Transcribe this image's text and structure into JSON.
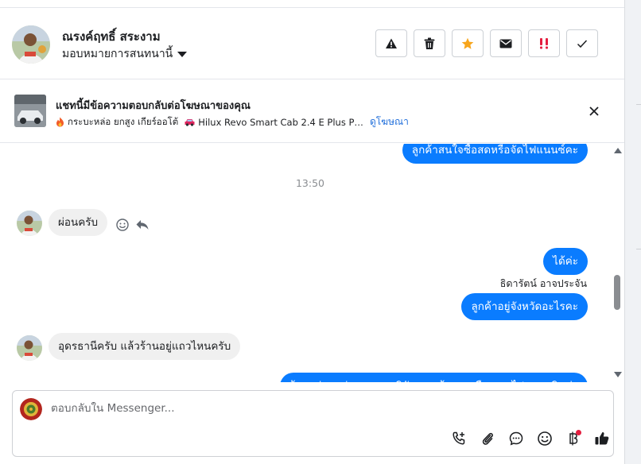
{
  "header": {
    "contact_name": "ณรงค์ฤทธิ์ สระงาม",
    "assign_label": "มอบหมายการสนทนานี้",
    "actions": [
      "warning-icon",
      "trash-icon",
      "star-icon",
      "envelope-icon",
      "spam-icon",
      "check-icon"
    ],
    "colors": {
      "star": "#f7a51c",
      "spam": "#e41e3f"
    }
  },
  "ad": {
    "title": "แชทนี้มีข้อความตอบกลับต่อโฆษณาของคุณ",
    "description_fire": "กระบะหล่อ ยกสูง เกียร์ออโต้",
    "description_car": "Hilux Revo Smart Cab 2.4 E Plus P…",
    "link_label": "ดูโฆษณา"
  },
  "thread": {
    "messages": [
      {
        "direction": "out",
        "text": "ลูกค้าสนใจซื้อสดหรือจัดไฟแนนซ์คะ"
      },
      {
        "type": "timestamp",
        "text": "13:50"
      },
      {
        "direction": "in",
        "text": "ผ่อนครับ"
      },
      {
        "direction": "out",
        "text": "ได้ค่ะ"
      },
      {
        "type": "sender",
        "text": "ธิดารัตน์ อาจประจัน"
      },
      {
        "direction": "out",
        "text": "ลูกค้าอยู่จังหวัดอะไรคะ"
      },
      {
        "direction": "in",
        "text": "อุดรธานีครับ แล้วร้านอยู่แถวไหนครับ"
      },
      {
        "direction": "out",
        "text": "ร้านอยู่อุดรค่ะ แถวแยกวิลัยพละเส้นรอบเมืองทางไปสนามบินค่ะ"
      }
    ]
  },
  "composer": {
    "placeholder": "ตอบกลับใน Messenger...",
    "tools": [
      "phone-add-icon",
      "paperclip-icon",
      "chat-bubble-icon",
      "emoji-icon",
      "baht-icon",
      "thumbs-up-icon"
    ]
  },
  "colors": {
    "outgoing_bubble": "#0a7cff",
    "incoming_bubble": "#f0f0f0",
    "link": "#216fdb"
  }
}
